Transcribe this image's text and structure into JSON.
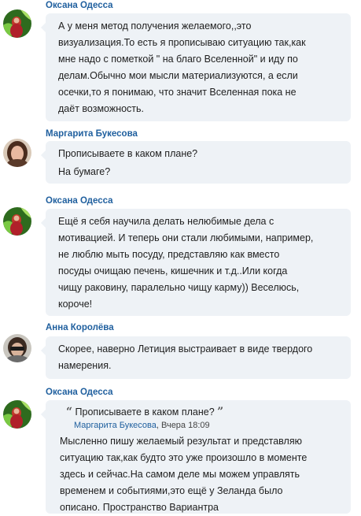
{
  "messages": [
    {
      "author": "Оксана Одесса",
      "lines": [
        "А у меня метод получения желаемого,,это",
        "визуализация.То есть я прописываю ситуацию так,как",
        "мне надо с пометкой \" на благо Вселенной\" и иду по",
        "делам.Обычно мои мысли материализуются, а если",
        "осечки,то я понимаю, что значит Вселенная пока не",
        "даёт возможность."
      ]
    },
    {
      "author": "Маргарита Букесова",
      "lines": [
        "Прописываете в каком плане?",
        "На бумаге?"
      ]
    },
    {
      "author": "Оксана Одесса",
      "lines": [
        "Ещё я себя научила делать нелюбимые дела с",
        "мотивацией. И теперь они стали любимыми, например,",
        "не люблю мыть посуду, представляю как вместо",
        "посуды очищаю печень, кишечник и т.д..Или когда",
        "чищу раковину, паралельно чищу карму)) Веселюсь,",
        "короче!"
      ]
    },
    {
      "author": "Анна Королёва",
      "lines": [
        "Скорее, наверно Летиция выстраивает в виде твердого",
        "намерения."
      ]
    },
    {
      "author": "Оксана Одесса",
      "quote": {
        "open_mark": "“",
        "text": "Прописываете в каком плане?",
        "close_mark": "”",
        "author": "Маргарита Букесова",
        "time": ", Вчера 18:09"
      },
      "lines": [
        "Мысленно пишу желаемый результат и представляю",
        "ситуацию так,как будто это уже произошло в моменте",
        "здесь и сейчас.На самом деле мы можем управлять",
        "временем и событиями,это ещё у Зеланда было",
        "описано. Пространство Вариантра"
      ]
    }
  ]
}
